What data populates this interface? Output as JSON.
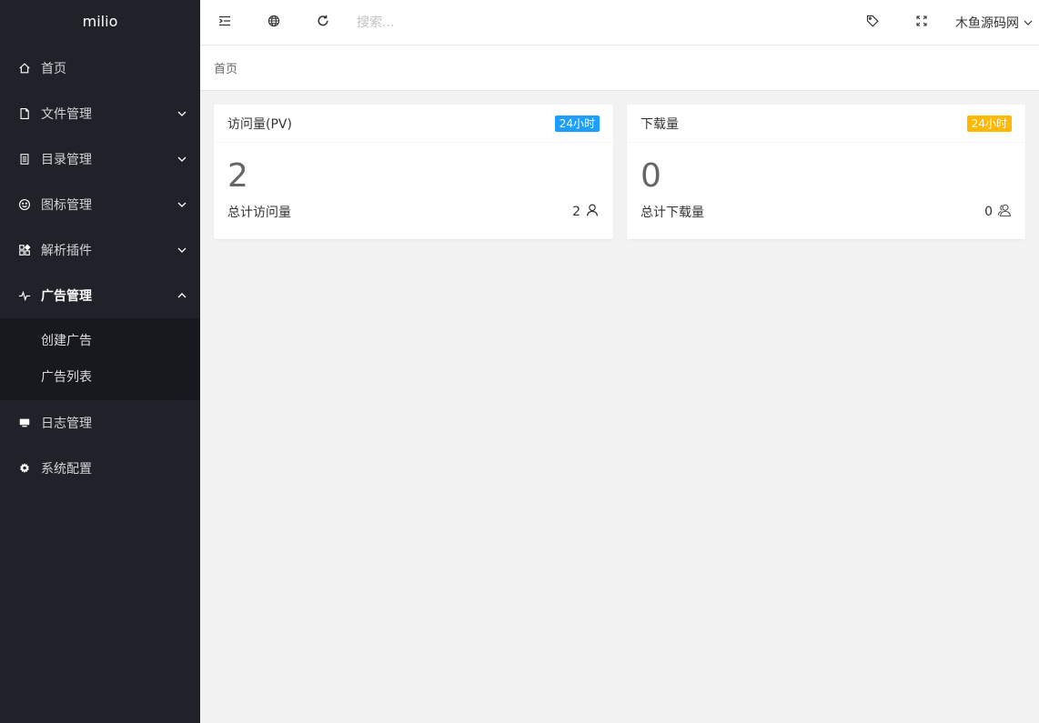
{
  "app": {
    "logo": "milio"
  },
  "sidebar": {
    "items": [
      {
        "label": "首页",
        "icon": "home-icon"
      },
      {
        "label": "文件管理",
        "icon": "file-icon"
      },
      {
        "label": "目录管理",
        "icon": "directory-icon"
      },
      {
        "label": "图标管理",
        "icon": "smile-icon"
      },
      {
        "label": "解析插件",
        "icon": "plugin-icon"
      },
      {
        "label": "广告管理",
        "icon": "pulse-icon",
        "expanded": true,
        "children": [
          {
            "label": "创建广告"
          },
          {
            "label": "广告列表"
          }
        ]
      },
      {
        "label": "日志管理",
        "icon": "monitor-icon"
      },
      {
        "label": "系统配置",
        "icon": "gear-icon"
      }
    ]
  },
  "header": {
    "search_placeholder": "搜索...",
    "user_name": "木鱼源码网"
  },
  "breadcrumb": {
    "current": "首页"
  },
  "cards": [
    {
      "title": "访问量(PV)",
      "badge": "24小时",
      "badge_color": "#1e9fff",
      "value": "2",
      "footer_label": "总计访问量",
      "footer_value": "2",
      "footer_icon": "user-icon"
    },
    {
      "title": "下载量",
      "badge": "24小时",
      "badge_color": "#ffb800",
      "value": "0",
      "footer_label": "总计下载量",
      "footer_value": "0",
      "footer_icon": "users-icon"
    }
  ],
  "colors": {
    "sidebar_bg": "#20222a",
    "submenu_bg": "#18191f",
    "page_bg": "#f2f2f2"
  }
}
